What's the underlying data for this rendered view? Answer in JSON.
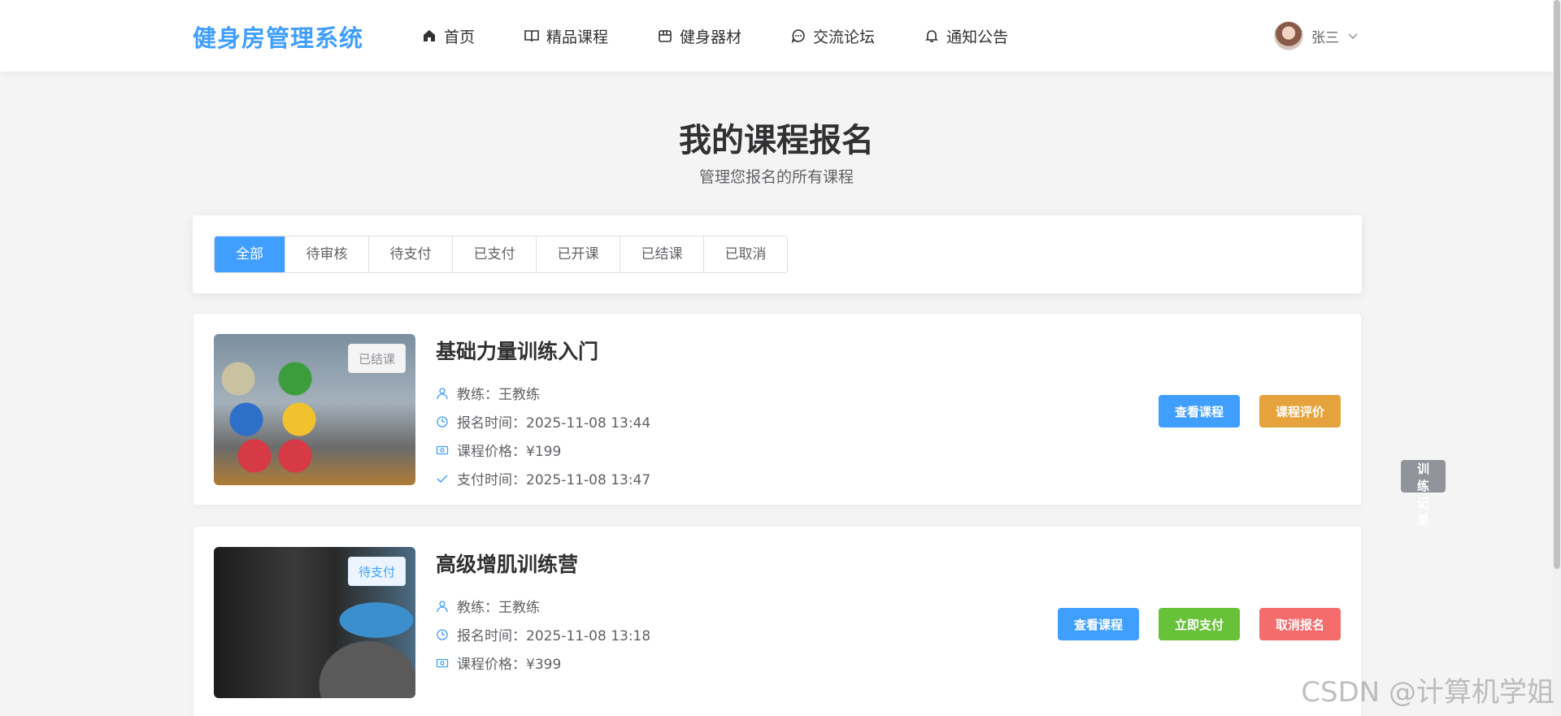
{
  "header": {
    "brand": "健身房管理系统",
    "nav": [
      {
        "label": "首页",
        "icon": "home-icon"
      },
      {
        "label": "精品课程",
        "icon": "book-icon"
      },
      {
        "label": "健身器材",
        "icon": "box-icon"
      },
      {
        "label": "交流论坛",
        "icon": "chat-icon"
      },
      {
        "label": "通知公告",
        "icon": "bell-icon"
      }
    ],
    "user": {
      "name": "张三"
    }
  },
  "page": {
    "title": "我的课程报名",
    "subtitle": "管理您报名的所有课程"
  },
  "filters": {
    "tabs": [
      "全部",
      "待审核",
      "待支付",
      "已支付",
      "已开课",
      "已结课",
      "已取消"
    ],
    "active": "全部"
  },
  "courses": [
    {
      "title": "基础力量训练入门",
      "status": "已结课",
      "coach": "教练：王教练",
      "signup_time": "报名时间：2025-11-08 13:44",
      "price": "课程价格：¥199",
      "pay_time": "支付时间：2025-11-08 13:47",
      "actions": [
        "查看课程",
        "训练记录",
        "课程评价"
      ]
    },
    {
      "title": "高级增肌训练营",
      "status": "待支付",
      "coach": "教练：王教练",
      "signup_time": "报名时间：2025-11-08 13:18",
      "price": "课程价格：¥399",
      "actions": [
        "查看课程",
        "立即支付",
        "取消报名"
      ]
    }
  ],
  "watermark": "CSDN @计算机学姐",
  "colors": {
    "primary": "#409eff",
    "info": "#909399",
    "warning": "#e6a23c",
    "success": "#67c23a",
    "danger": "#f56c6c",
    "background": "#f4f4f4"
  }
}
